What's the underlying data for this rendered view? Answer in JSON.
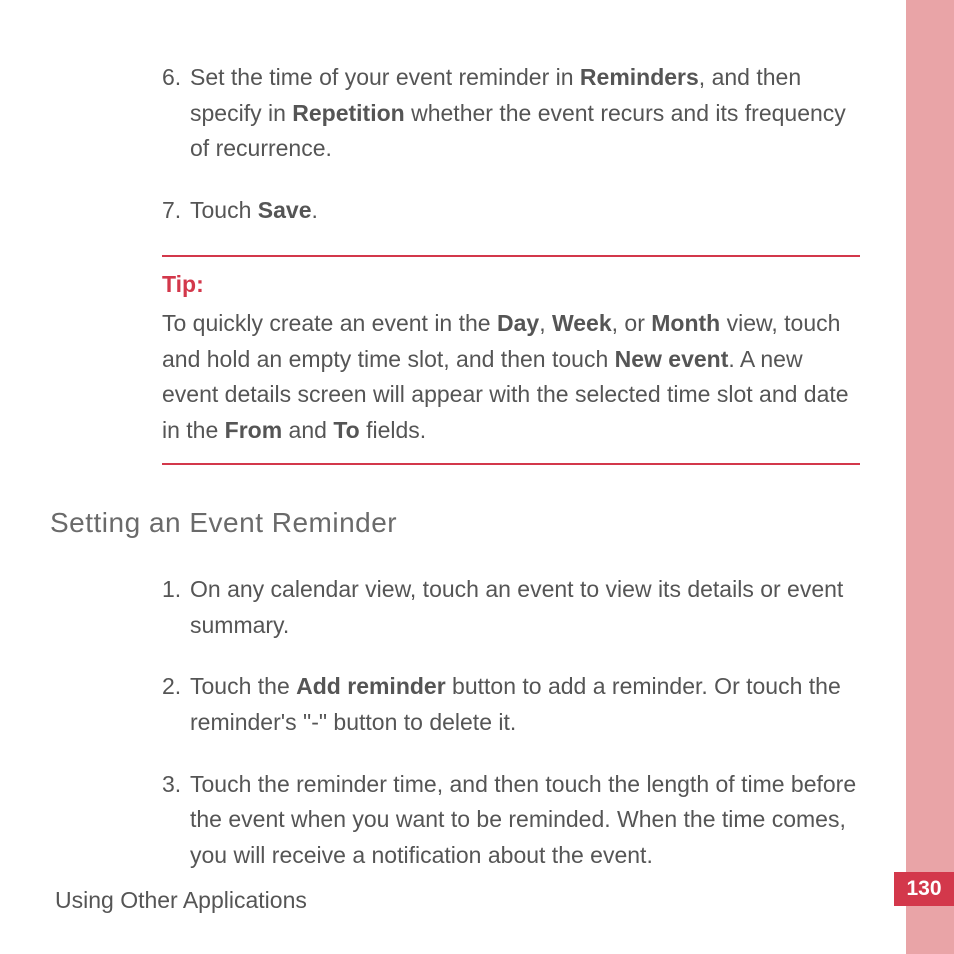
{
  "steps_top": [
    {
      "num": "6.",
      "segments": [
        {
          "t": "Set the time of your event reminder in "
        },
        {
          "t": "Reminders",
          "b": true
        },
        {
          "t": ", and then specify in "
        },
        {
          "t": "Repetition",
          "b": true
        },
        {
          "t": " whether the event recurs and its frequency of recurrence."
        }
      ]
    },
    {
      "num": "7.",
      "segments": [
        {
          "t": "Touch "
        },
        {
          "t": "Save",
          "b": true
        },
        {
          "t": "."
        }
      ]
    }
  ],
  "tip": {
    "label": "Tip:",
    "segments": [
      {
        "t": "To quickly create an event in the "
      },
      {
        "t": "Day",
        "b": true
      },
      {
        "t": ", "
      },
      {
        "t": "Week",
        "b": true
      },
      {
        "t": ", or "
      },
      {
        "t": "Month",
        "b": true
      },
      {
        "t": " view, touch and hold an empty time slot, and then touch "
      },
      {
        "t": "New event",
        "b": true
      },
      {
        "t": ". A new event details screen will appear with the selected time slot and date in the "
      },
      {
        "t": "From",
        "b": true
      },
      {
        "t": " and "
      },
      {
        "t": "To",
        "b": true
      },
      {
        "t": " fields."
      }
    ]
  },
  "section_heading": "Setting  an  Event  Reminder",
  "steps_bottom": [
    {
      "num": "1.",
      "segments": [
        {
          "t": "On any calendar view, touch an event to view its details or event summary."
        }
      ]
    },
    {
      "num": "2.",
      "segments": [
        {
          "t": "Touch the "
        },
        {
          "t": "Add reminder",
          "b": true
        },
        {
          "t": " button to add a reminder. Or touch the reminder's \"-\" button to delete it."
        }
      ]
    },
    {
      "num": "3.",
      "segments": [
        {
          "t": "Touch the reminder time, and then touch the length of time before the event when you want to be reminded. When the time comes, you will receive a notification about the event."
        }
      ]
    }
  ],
  "footer": "Using Other Applications",
  "page_number": "130"
}
